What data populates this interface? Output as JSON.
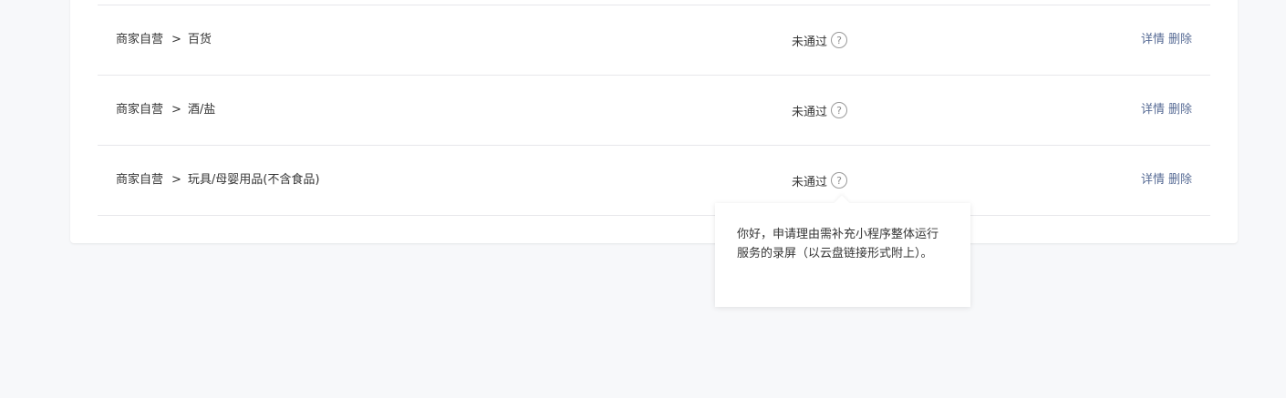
{
  "rows": [
    {
      "category_parent": "商家自营",
      "separator": ">",
      "category_child": "百货",
      "status": "未通过",
      "detail_label": "详情",
      "delete_label": "删除"
    },
    {
      "category_parent": "商家自营",
      "separator": ">",
      "category_child": "酒/盐",
      "status": "未通过",
      "detail_label": "详情",
      "delete_label": "删除"
    },
    {
      "category_parent": "商家自营",
      "separator": ">",
      "category_child": "玩具/母婴用品(不含食品)",
      "status": "未通过",
      "detail_label": "详情",
      "delete_label": "删除"
    }
  ],
  "help_icon_glyph": "?",
  "tooltip": {
    "text": "你好，申请理由需补充小程序整体运行服务的录屏（以云盘链接形式附上）。"
  },
  "colors": {
    "link": "#576b95",
    "background": "#f7f8fa",
    "divider": "#e7e7eb"
  }
}
